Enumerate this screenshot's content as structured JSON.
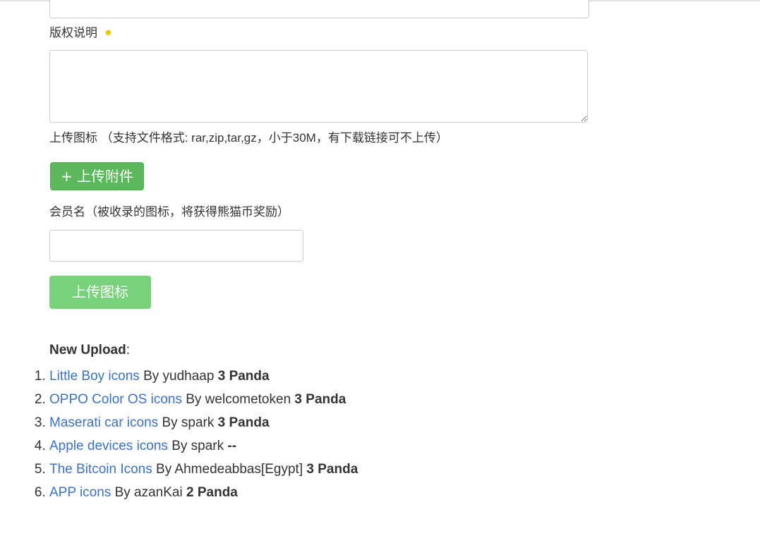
{
  "form": {
    "copyright_label": "版权说明",
    "required_icon": "asterisk-icon",
    "upload_icon_label": "上传图标 （支持文件格式: rar,zip,tar,gz，小于30M，有下载链接可不上传）",
    "attach_button_label": "+ 上传附件",
    "member_label": "会员名（被收录的图标，将获得熊猫币奖励）",
    "member_value": "",
    "submit_button_label": "上传图标"
  },
  "new_upload": {
    "heading": "New Upload",
    "suffix": ":",
    "items": [
      {
        "title": "Little Boy icons",
        "by": "By yudhaap",
        "amount": "3 Panda"
      },
      {
        "title": "OPPO Color OS icons",
        "by": "By welcometoken",
        "amount": "3 Panda"
      },
      {
        "title": "Maserati car icons",
        "by": "By spark",
        "amount": "3 Panda"
      },
      {
        "title": "Apple devices icons",
        "by": "By spark",
        "amount": "--"
      },
      {
        "title": "The Bitcoin Icons",
        "by": "By Ahmedeabbas[Egypt]",
        "amount": "3 Panda"
      },
      {
        "title": "APP icons",
        "by": "By azanKai",
        "amount": "2 Panda"
      }
    ]
  },
  "colors": {
    "link": "#3c73c4",
    "attach_button": "#5cb85c",
    "submit_button": "#78d27c",
    "required_icon": "#e6c800"
  }
}
